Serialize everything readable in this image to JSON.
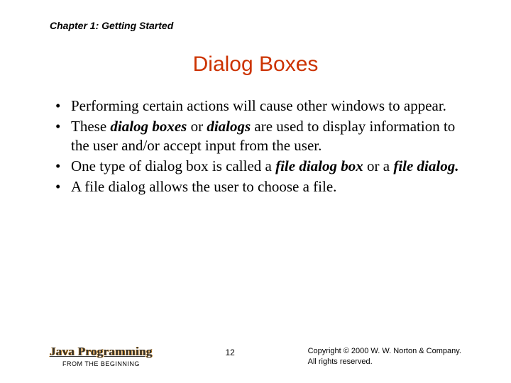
{
  "chapter": "Chapter 1: Getting Started",
  "title": "Dialog Boxes",
  "bullets": {
    "b1": "Performing certain actions will cause other windows to appear.",
    "b2a": "These ",
    "b2t1": "dialog boxes",
    "b2b": " or ",
    "b2t2": "dialogs",
    "b2c": " are used to display information to the user and/or accept input from the user.",
    "b3a": "One type of dialog box is called a ",
    "b3t1": "file dialog box",
    "b3b": " or a ",
    "b3t2": "file dialog.",
    "b4": "A file dialog allows the user to choose a file."
  },
  "footer": {
    "book_title": "Java Programming",
    "book_sub": "FROM THE BEGINNING",
    "page": "12",
    "copyright_l1": "Copyright © 2000 W. W. Norton & Company.",
    "copyright_l2": "All rights reserved."
  }
}
